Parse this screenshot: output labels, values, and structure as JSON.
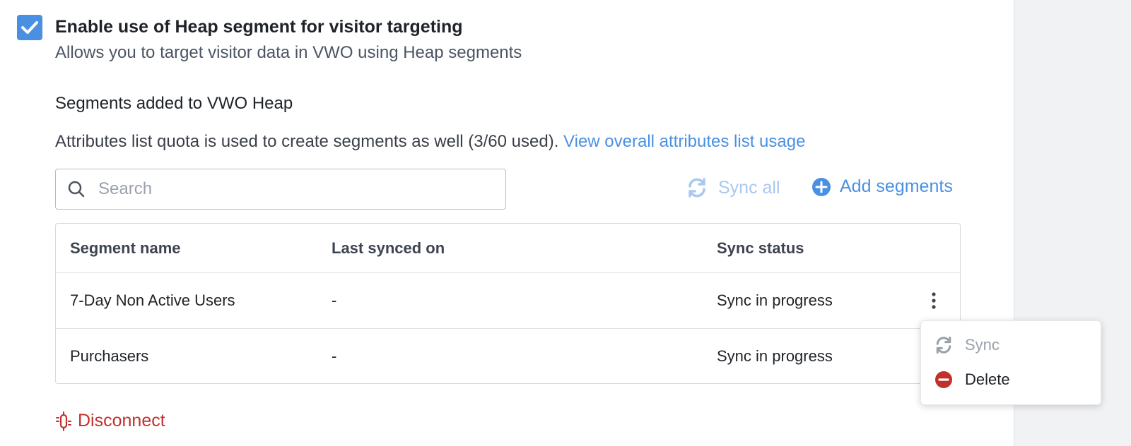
{
  "integration": {
    "enable_label": "Enable use of Heap segment for visitor targeting",
    "enable_description": "Allows you to target visitor data in VWO using Heap segments",
    "enabled": true
  },
  "segments": {
    "section_title": "Segments added to VWO Heap",
    "quota_text": "Attributes list quota is used to create segments as well (3/60 used).",
    "quota_link": "View overall attributes list usage",
    "search_placeholder": "Search",
    "sync_all_label": "Sync all",
    "add_segments_label": "Add segments",
    "table": {
      "columns": [
        "Segment name",
        "Last synced on",
        "Sync status"
      ],
      "rows": [
        {
          "name": "7-Day Non Active Users",
          "last_synced": "-",
          "status": "Sync in progress"
        },
        {
          "name": "Purchasers",
          "last_synced": "-",
          "status": "Sync in progress"
        }
      ]
    },
    "row_menu": {
      "sync_label": "Sync",
      "delete_label": "Delete"
    }
  },
  "disconnect_label": "Disconnect",
  "colors": {
    "accent": "#4a90e2",
    "disabled": "#a8c8ef",
    "danger": "#c0312b"
  }
}
